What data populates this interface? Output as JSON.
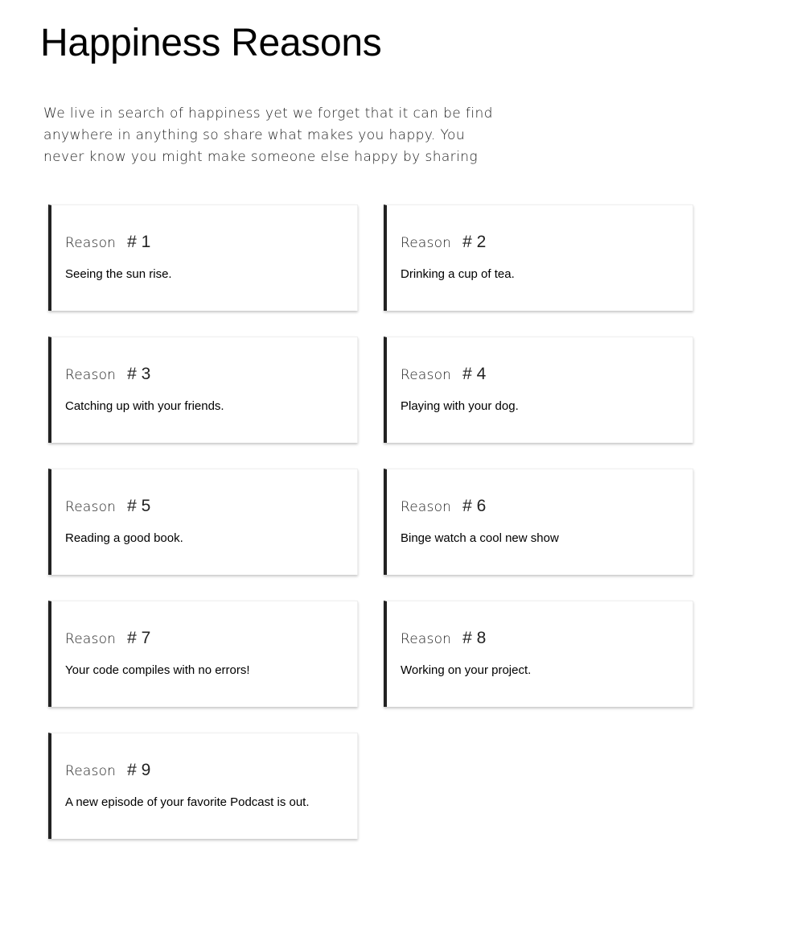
{
  "page": {
    "title": "Happiness Reasons",
    "intro": "We live in search of happiness yet we forget that it can be find anywhere in anything so share what makes you happy. You never know you might make someone else happy by sharing"
  },
  "reasons": [
    {
      "label": "Reason",
      "number": "# 1",
      "text": "Seeing the sun rise."
    },
    {
      "label": "Reason",
      "number": "# 2",
      "text": "Drinking a cup of tea."
    },
    {
      "label": "Reason",
      "number": "# 3",
      "text": "Catching up with your friends."
    },
    {
      "label": "Reason",
      "number": "# 4",
      "text": "Playing with your dog."
    },
    {
      "label": "Reason",
      "number": "# 5",
      "text": "Reading a good book."
    },
    {
      "label": "Reason",
      "number": "# 6",
      "text": "Binge watch a cool new show"
    },
    {
      "label": "Reason",
      "number": "# 7",
      "text": "Your code compiles with no errors!"
    },
    {
      "label": "Reason",
      "number": "# 8",
      "text": "Working on your project."
    },
    {
      "label": "Reason",
      "number": "# 9",
      "text": "A new episode of your favorite Podcast is out."
    }
  ]
}
